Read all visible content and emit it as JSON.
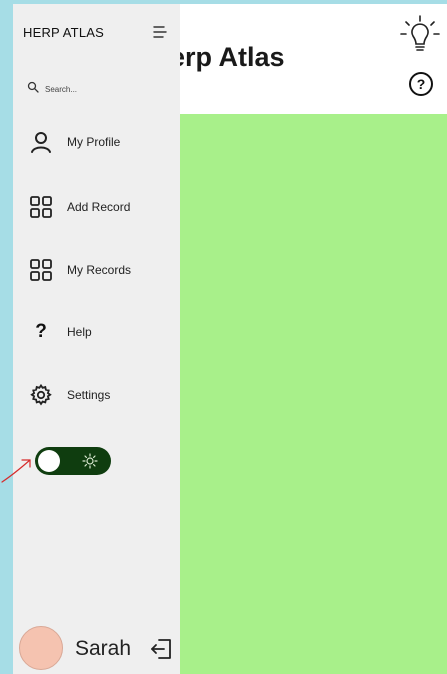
{
  "header": {
    "title": "erp Atlas",
    "bulb_icon": "lightbulb-icon",
    "help_icon": "help-circle-icon"
  },
  "sidebar": {
    "brand": "HERP ATLAS",
    "menu_icon": "menu-lines-icon",
    "search": {
      "placeholder": "Search...",
      "icon": "search-icon"
    },
    "items": [
      {
        "label": "My Profile",
        "icon": "user-icon"
      },
      {
        "label": "Add Record",
        "icon": "grid-icon"
      },
      {
        "label": "My Records",
        "icon": "grid-icon"
      },
      {
        "label": "Help",
        "icon": "question-mark-icon",
        "glyph": "?"
      },
      {
        "label": "Settings",
        "icon": "gear-icon"
      }
    ],
    "theme_toggle": {
      "state": "off",
      "icon": "sun-icon"
    }
  },
  "user": {
    "name": "Sarah",
    "logout_icon": "logout-icon"
  },
  "colors": {
    "outer_background": "#a6dde6",
    "sidebar_background": "#efefef",
    "content_background": "#a8f08a",
    "toggle_background": "#0f3d0f",
    "avatar": "#f5c3b0",
    "annotation_arrow": "#d62b2b"
  }
}
